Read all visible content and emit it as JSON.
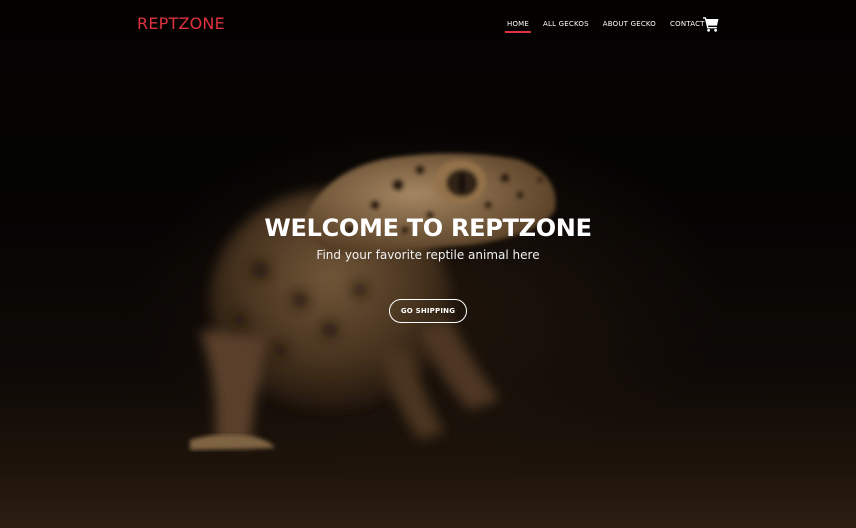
{
  "brand": {
    "name": "REPTZONE",
    "color": "#e0323e"
  },
  "nav": {
    "items": [
      {
        "label": "HOME",
        "active": true
      },
      {
        "label": "ALL GECKOS",
        "active": false
      },
      {
        "label": "ABOUT GECKO",
        "active": false
      },
      {
        "label": "CONTACT",
        "active": false
      }
    ],
    "cart_icon": "shopping-cart-icon"
  },
  "hero": {
    "title": "WELCOME TO REPTZONE",
    "subtitle": "Find your favorite reptile animal here",
    "cta_label": "GO SHIPPING",
    "background_image": "leopard-gecko-photo"
  },
  "colors": {
    "accent": "#e0323e",
    "text": "#ffffff",
    "background": "#000000"
  }
}
